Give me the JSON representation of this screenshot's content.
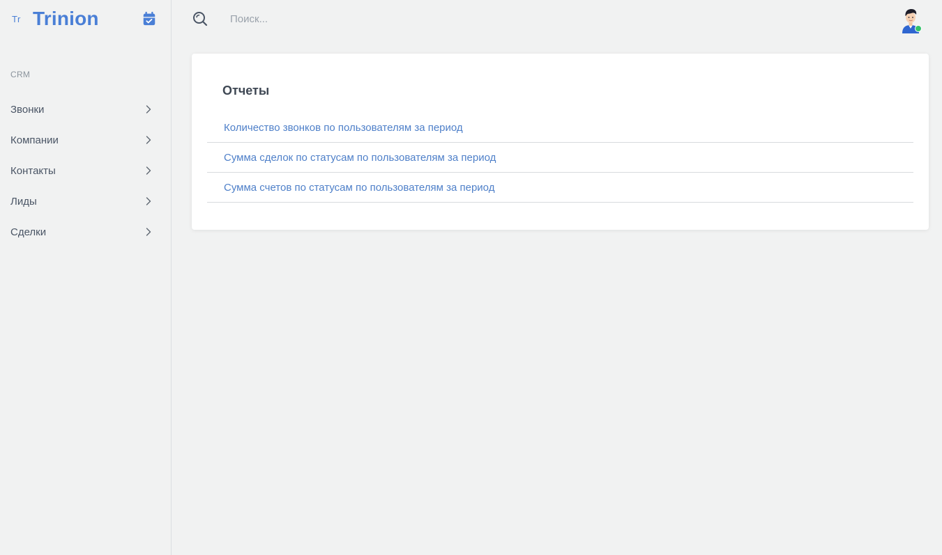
{
  "brand": {
    "mark": "Tr",
    "name": "Trinion",
    "calendar_icon": "calendar-check-icon"
  },
  "sidebar": {
    "section_label": "CRM",
    "items": [
      {
        "label": "Звонки",
        "icon": "chevron-right-icon"
      },
      {
        "label": "Компании",
        "icon": "chevron-right-icon"
      },
      {
        "label": "Контакты",
        "icon": "chevron-right-icon"
      },
      {
        "label": "Лиды",
        "icon": "chevron-right-icon"
      },
      {
        "label": "Сделки",
        "icon": "chevron-right-icon"
      }
    ]
  },
  "topbar": {
    "search": {
      "value": "",
      "placeholder": "Поиск...",
      "icon": "search-icon"
    },
    "avatar": {
      "icon": "user-avatar",
      "status": "online"
    }
  },
  "main": {
    "card": {
      "title": "Отчеты",
      "reports": [
        {
          "label": "Количество звонков по пользователям за период"
        },
        {
          "label": "Сумма сделок по статусам по пользователям за период"
        },
        {
          "label": "Сумма счетов по статусам по пользователям за период"
        }
      ]
    }
  },
  "colors": {
    "brand": "#4a7fd6",
    "link": "#4f80c9",
    "background": "#f1f2f2",
    "card": "#ffffff",
    "status_online": "#34c26b"
  }
}
